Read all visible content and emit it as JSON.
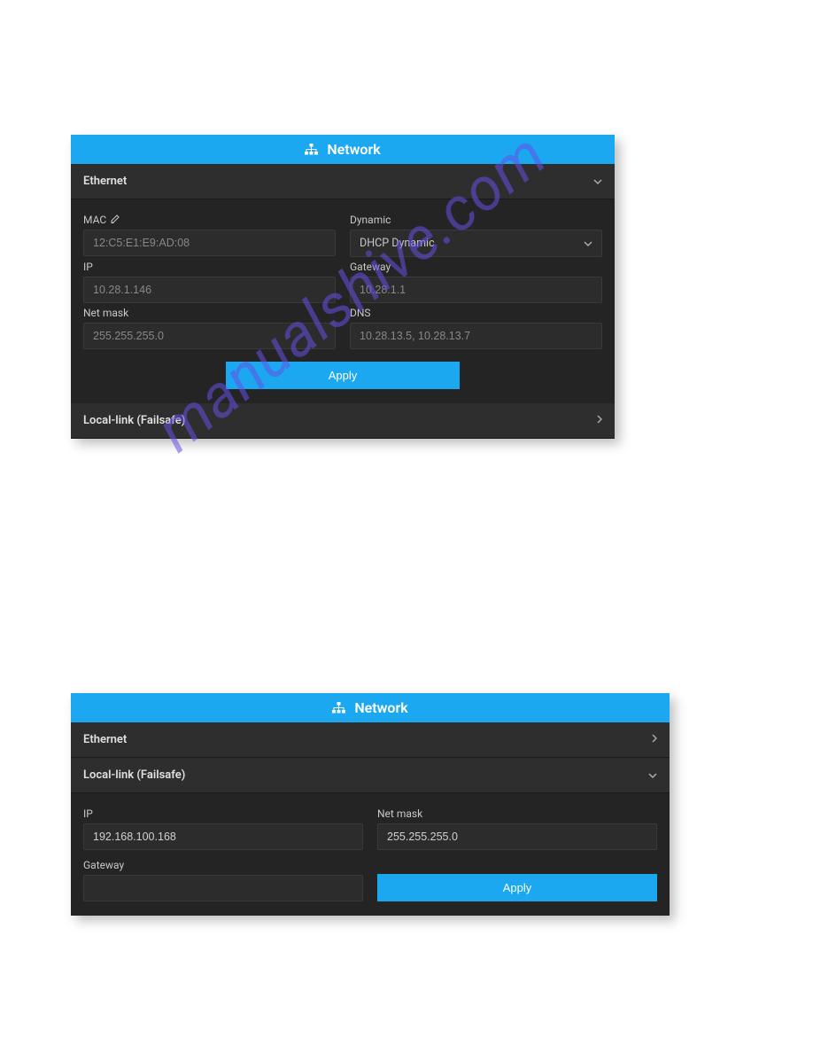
{
  "watermark": "manualshive.com",
  "panel1": {
    "header": "Network",
    "ethernet": {
      "title": "Ethernet",
      "mac_label": "MAC",
      "mac_value": "12:C5:E1:E9:AD:08",
      "dynamic_label": "Dynamic",
      "dynamic_value": "DHCP Dynamic",
      "ip_label": "IP",
      "ip_value": "10.28.1.146",
      "gateway_label": "Gateway",
      "gateway_value": "10.28.1.1",
      "netmask_label": "Net mask",
      "netmask_value": "255.255.255.0",
      "dns_label": "DNS",
      "dns_value": "10.28.13.5, 10.28.13.7",
      "apply_label": "Apply"
    },
    "locallink": {
      "title": "Local-link (Failsafe)"
    }
  },
  "panel2": {
    "header": "Network",
    "ethernet": {
      "title": "Ethernet"
    },
    "locallink": {
      "title": "Local-link (Failsafe)",
      "ip_label": "IP",
      "ip_value": "192.168.100.168",
      "netmask_label": "Net mask",
      "netmask_value": "255.255.255.0",
      "gateway_label": "Gateway",
      "gateway_value": "",
      "apply_label": "Apply"
    }
  }
}
